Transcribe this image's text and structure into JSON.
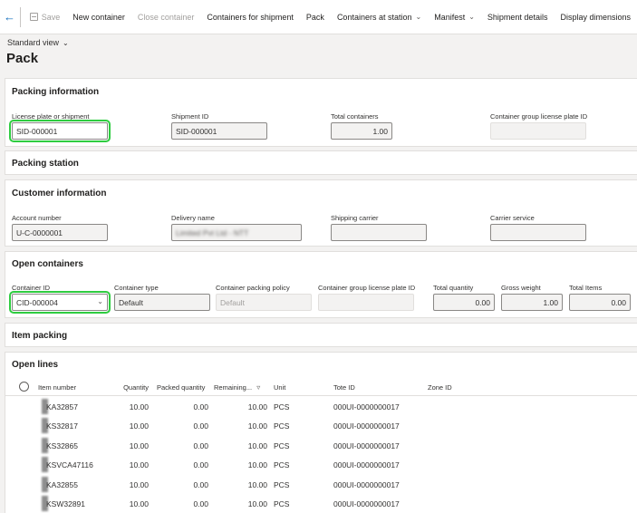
{
  "toolbar": {
    "items": [
      {
        "label": "Save",
        "disabled": true
      },
      {
        "label": "New container",
        "disabled": false
      },
      {
        "label": "Close container",
        "disabled": true
      },
      {
        "label": "Containers for shipment",
        "disabled": false
      },
      {
        "label": "Pack",
        "disabled": false
      },
      {
        "label": "Containers at station",
        "disabled": false,
        "dropdown": true
      },
      {
        "label": "Manifest",
        "disabled": false,
        "dropdown": true
      },
      {
        "label": "Shipment details",
        "disabled": false
      },
      {
        "label": "Display dimensions",
        "disabled": false
      }
    ]
  },
  "view": {
    "label": "Standard view"
  },
  "page": {
    "title": "Pack"
  },
  "packing_information": {
    "title": "Packing information",
    "license_plate": {
      "label": "License plate or shipment",
      "value": "SID-000001"
    },
    "shipment_id": {
      "label": "Shipment ID",
      "value": "SID-000001"
    },
    "total_containers": {
      "label": "Total containers",
      "value": "1.00"
    },
    "container_group_lp": {
      "label": "Container group license plate ID",
      "value": ""
    }
  },
  "packing_station": {
    "title": "Packing station"
  },
  "customer_information": {
    "title": "Customer information",
    "account_number": {
      "label": "Account number",
      "value": "U-C-0000001"
    },
    "delivery_name": {
      "label": "Delivery name",
      "value": "Limited Pvt Ltd - NTT"
    },
    "shipping_carrier": {
      "label": "Shipping carrier",
      "value": ""
    },
    "carrier_service": {
      "label": "Carrier service",
      "value": ""
    }
  },
  "open_containers": {
    "title": "Open containers",
    "container_id": {
      "label": "Container ID",
      "value": "CID-000004"
    },
    "container_type": {
      "label": "Container type",
      "value": "Default"
    },
    "packing_policy": {
      "label": "Container packing policy",
      "value": "Default"
    },
    "group_lp": {
      "label": "Container group license plate ID",
      "value": ""
    },
    "total_quantity": {
      "label": "Total quantity",
      "value": "0.00"
    },
    "gross_weight": {
      "label": "Gross weight",
      "value": "1.00"
    },
    "total_items": {
      "label": "Total Items",
      "value": "0.00"
    }
  },
  "item_packing": {
    "title": "Item packing"
  },
  "open_lines": {
    "title": "Open lines",
    "columns": {
      "item_number": "Item number",
      "quantity": "Quantity",
      "packed_quantity": "Packed quantity",
      "remaining": "Remaining...",
      "unit": "Unit",
      "tote_id": "Tote ID",
      "zone_id": "Zone ID"
    },
    "rows": [
      {
        "item": "KA32857",
        "qty": "10.00",
        "packed": "0.00",
        "remaining": "10.00",
        "unit": "PCS",
        "tote": "000UI-0000000017",
        "zone": ""
      },
      {
        "item": "KS32817",
        "qty": "10.00",
        "packed": "0.00",
        "remaining": "10.00",
        "unit": "PCS",
        "tote": "000UI-0000000017",
        "zone": ""
      },
      {
        "item": "KS32865",
        "qty": "10.00",
        "packed": "0.00",
        "remaining": "10.00",
        "unit": "PCS",
        "tote": "000UI-0000000017",
        "zone": ""
      },
      {
        "item": "KSVCA47116",
        "qty": "10.00",
        "packed": "0.00",
        "remaining": "10.00",
        "unit": "PCS",
        "tote": "000UI-0000000017",
        "zone": ""
      },
      {
        "item": "KA32855",
        "qty": "10.00",
        "packed": "0.00",
        "remaining": "10.00",
        "unit": "PCS",
        "tote": "000UI-0000000017",
        "zone": ""
      },
      {
        "item": "KSW32891",
        "qty": "10.00",
        "packed": "0.00",
        "remaining": "10.00",
        "unit": "PCS",
        "tote": "000UI-0000000017",
        "zone": ""
      }
    ]
  },
  "colors": {
    "accent": "#0f6cbd",
    "highlight": "#2ecc40",
    "background": "#f3f2f1"
  }
}
